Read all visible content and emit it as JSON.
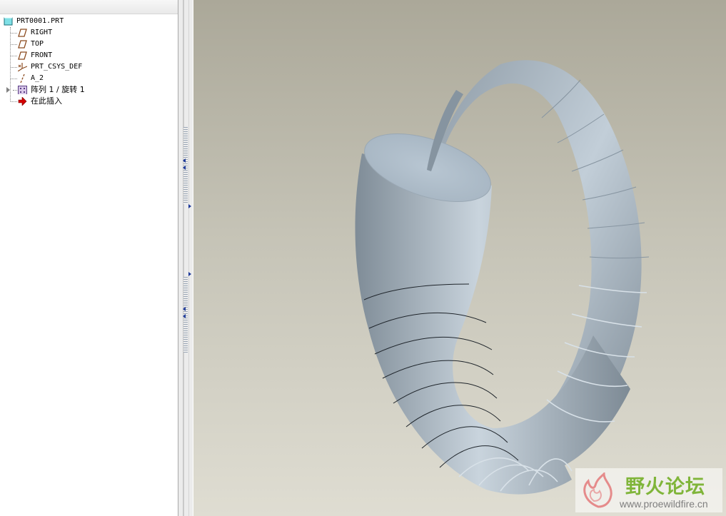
{
  "model_tree": {
    "root": {
      "label": "PRT0001.PRT",
      "icon": "part-icon"
    },
    "items": [
      {
        "label": "RIGHT",
        "icon": "datum-plane-icon"
      },
      {
        "label": "TOP",
        "icon": "datum-plane-icon"
      },
      {
        "label": "FRONT",
        "icon": "datum-plane-icon"
      },
      {
        "label": "PRT_CSYS_DEF",
        "icon": "coordinate-system-icon"
      },
      {
        "label": "A_2",
        "icon": "datum-axis-icon"
      },
      {
        "label": "阵列 1 / 旋转 1",
        "icon": "pattern-icon"
      },
      {
        "label": "在此插入",
        "icon": "insert-here-arrow-icon"
      }
    ]
  },
  "watermark": {
    "name": "野火论坛",
    "url": "www.proewildfire.cn"
  },
  "colors": {
    "graphics_bg_top": "#aba899",
    "graphics_bg_bottom": "#dfddd2",
    "model_shade": "#9aa8b4",
    "watermark_green": "#80b53a"
  }
}
